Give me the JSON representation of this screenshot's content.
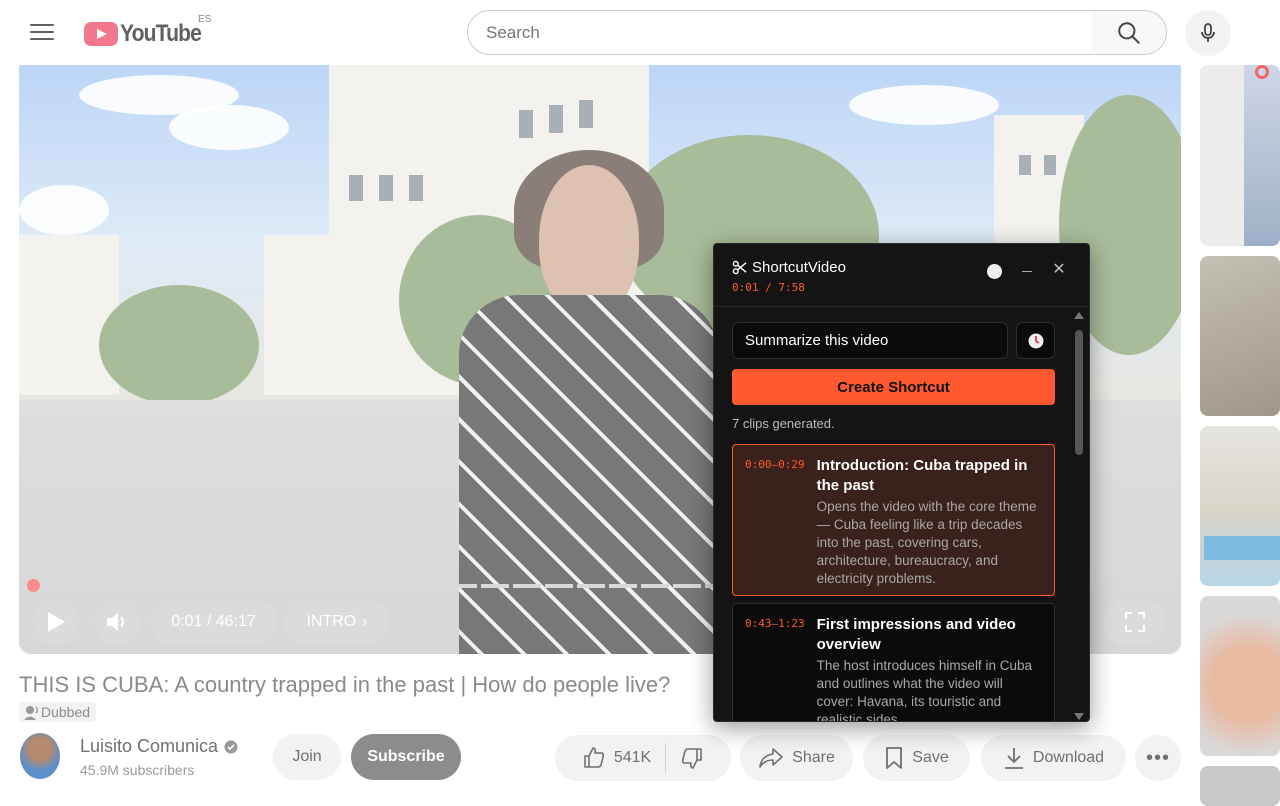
{
  "header": {
    "logo_text": "YouTube",
    "country_code": "ES",
    "search_placeholder": "Search"
  },
  "player": {
    "time": "0:01 / 46:17",
    "chapter": "INTRO",
    "progress_fraction": 0.0004
  },
  "video": {
    "title": "THIS IS CUBA: A country trapped in the past | How do people live?",
    "dubbed_label": "Dubbed",
    "channel_name": "Luisito Comunica",
    "subscribers": "45.9M subscribers",
    "join_label": "Join",
    "subscribe_label": "Subscribe",
    "likes": "541K",
    "share_label": "Share",
    "save_label": "Save",
    "download_label": "Download",
    "more_label": "•••"
  },
  "shortcut_panel": {
    "title": "ShortcutVideo",
    "time": "0:01 / 7:58",
    "prompt_value": "Summarize this video",
    "create_label": "Create Shortcut",
    "clips_count": "7 clips generated.",
    "clips": [
      {
        "time": "0:00–0:29",
        "title": "Introduction: Cuba trapped in the past",
        "description": "Opens the video with the core theme — Cuba feeling like a trip decades into the past, covering cars, architecture, bureaucracy, and electricity problems."
      },
      {
        "time": "0:43–1:23",
        "title": "First impressions and video overview",
        "description": "The host introduces himself in Cuba and outlines what the video will cover: Havana, its touristic and realistic sides."
      }
    ]
  },
  "colors": {
    "accent": "#ff5a2f",
    "panel_bg": "#141414",
    "youtube_red": "#f2798d"
  },
  "icons": [
    "menu-icon",
    "search-icon",
    "mic-icon",
    "play-icon",
    "volume-icon",
    "fullscreen-icon",
    "verified-icon",
    "like-icon",
    "dislike-icon",
    "share-icon",
    "save-icon",
    "download-icon",
    "scissors-icon",
    "timer-icon",
    "close-icon"
  ]
}
